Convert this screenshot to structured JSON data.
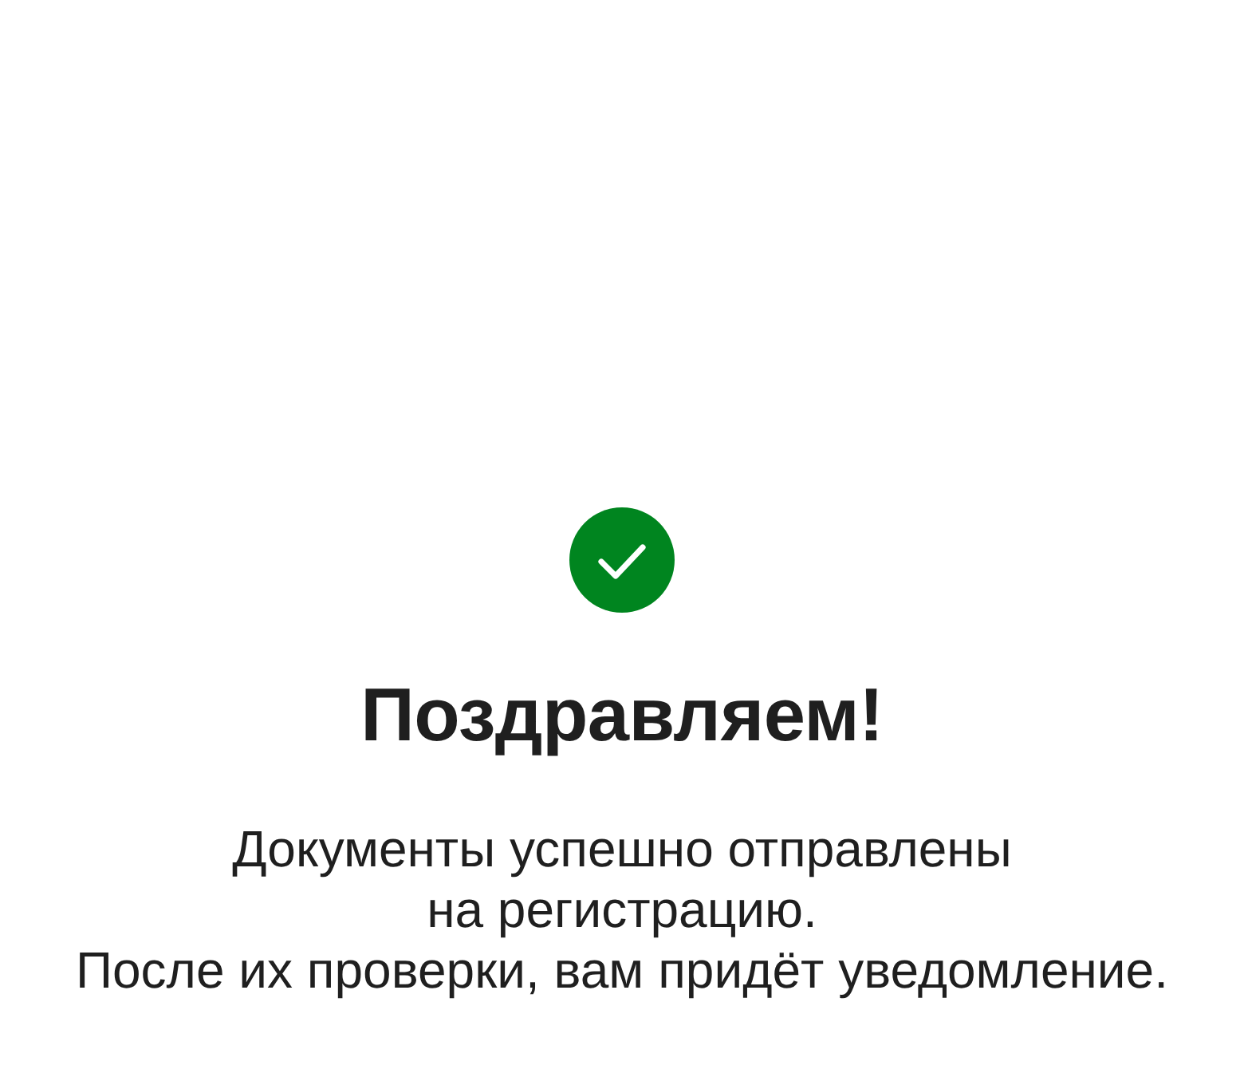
{
  "title": "Поздравляем!",
  "message": {
    "lines": [
      "Документы успешно отправлены",
      "на регистрацию.",
      "После их проверки, вам придёт уведомление."
    ]
  }
}
